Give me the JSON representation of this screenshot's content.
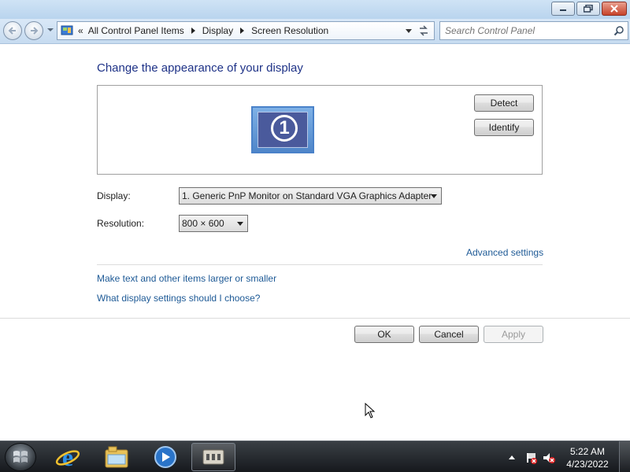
{
  "window": {
    "caption_buttons": [
      "minimize",
      "restore",
      "close"
    ]
  },
  "navigation": {
    "breadcrumb_overflow": "«",
    "breadcrumbs": [
      "All Control Panel Items",
      "Display",
      "Screen Resolution"
    ],
    "search_placeholder": "Search Control Panel"
  },
  "content": {
    "heading": "Change the appearance of your display",
    "monitor_number": "1",
    "detect_label": "Detect",
    "identify_label": "Identify",
    "display_label": "Display:",
    "display_value": "1. Generic PnP Monitor on Standard VGA Graphics Adapter",
    "resolution_label": "Resolution:",
    "resolution_value": "800 × 600",
    "advanced_settings_link": "Advanced settings",
    "text_size_link": "Make text and other items larger or smaller",
    "help_link": "What display settings should I choose?"
  },
  "buttons": {
    "ok": "OK",
    "cancel": "Cancel",
    "apply": "Apply"
  },
  "taskbar": {
    "pinned_apps": [
      "start-orb",
      "internet-explorer-icon",
      "windows-explorer-icon",
      "media-player-icon",
      "control-panel-icon"
    ],
    "clock_time": "5:22 AM",
    "clock_date": "4/23/2022"
  },
  "colors": {
    "heading": "#1e3287",
    "link": "#1e5a96",
    "taskbar": "#1f2327"
  }
}
